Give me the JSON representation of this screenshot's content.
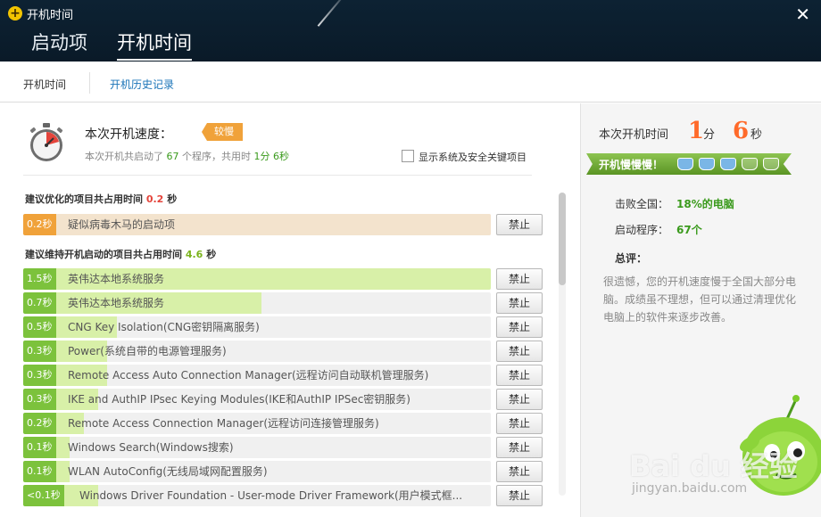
{
  "window": {
    "title": "开机时间",
    "close_label": "✕"
  },
  "top_tabs": [
    {
      "label": "启动项"
    },
    {
      "label": "开机时间"
    }
  ],
  "sub_tabs": [
    {
      "label": "开机时间"
    },
    {
      "label": "开机历史记录"
    }
  ],
  "summary": {
    "title": "本次开机速度：",
    "badge": "较慢",
    "desc_prefix": "本次开机共启动了",
    "program_count": "67",
    "desc_mid": "个程序，共用时",
    "duration": "1分 6秒",
    "show_system_label": "显示系统及安全关键项目"
  },
  "section_optimize": {
    "title_prefix": "建议优化的项目共占用时间",
    "time": "0.2",
    "unit": "秒",
    "items": [
      {
        "time": "0.2秒",
        "name": "疑似病毒木马的启动项",
        "fraction": 1.0,
        "button": "禁止"
      }
    ]
  },
  "section_keep": {
    "title_prefix": "建议维持开机启动的项目共占用时间",
    "time": "4.6",
    "unit": "秒",
    "items": [
      {
        "time": "1.5秒",
        "name": "英伟达本地系统服务",
        "fraction": 1.0,
        "button": "禁止"
      },
      {
        "time": "0.7秒",
        "name": "英伟达本地系统服务",
        "fraction": 0.51,
        "button": "禁止"
      },
      {
        "time": "0.5秒",
        "name": "CNG Key Isolation(CNG密钥隔离服务)",
        "fraction": 0.2,
        "button": "禁止"
      },
      {
        "time": "0.3秒",
        "name": "Power(系统自带的电源管理服务)",
        "fraction": 0.18,
        "button": "禁止"
      },
      {
        "time": "0.3秒",
        "name": "Remote Access Auto Connection Manager(远程访问自动联机管理服务)",
        "fraction": 0.18,
        "button": "禁止"
      },
      {
        "time": "0.3秒",
        "name": "IKE and AuthIP IPsec Keying Modules(IKE和AuthIP IPSec密钥服务)",
        "fraction": 0.16,
        "button": "禁止"
      },
      {
        "time": "0.2秒",
        "name": "Remote Access Connection Manager(远程访问连接管理服务)",
        "fraction": 0.13,
        "button": "禁止"
      },
      {
        "time": "0.1秒",
        "name": "Windows Search(Windows搜索)",
        "fraction": 0.1,
        "button": "禁止"
      },
      {
        "time": "0.1秒",
        "name": "WLAN AutoConfig(无线局域网配置服务)",
        "fraction": 0.1,
        "button": "禁止"
      },
      {
        "time": "<0.1秒",
        "name": "Windows Driver Foundation - User-mode Driver Framework(用户模式框...",
        "fraction": 0.16,
        "button": "禁止"
      }
    ]
  },
  "side": {
    "boot_time_label": "本次开机时间",
    "minutes": "1",
    "minutes_unit": "分",
    "seconds": "6",
    "seconds_unit": "秒",
    "ribbon": "开机慢慢慢！",
    "cups_filled": 3,
    "cups_total": 5,
    "beat_label": "击败全国：",
    "beat_value": "18%的电脑",
    "programs_label": "启动程序：",
    "programs_value": "67个",
    "comment_label": "总评：",
    "comment_text": "很遗憾，您的开机速度慢于全国大部分电脑。成绩虽不理想，但可以通过清理优化电脑上的软件来逐步改善。"
  },
  "watermark": {
    "main": "Bai du 经验",
    "sub": "jingyan.baidu.com"
  },
  "colors": {
    "header_bg": "#0d2233",
    "accent_blue": "#1a74b8",
    "bar_green": "#7cc23c",
    "bar_orange": "#f0a23a",
    "digit_orange": "#ff6a2a",
    "ok_green": "#3a9a1c"
  }
}
